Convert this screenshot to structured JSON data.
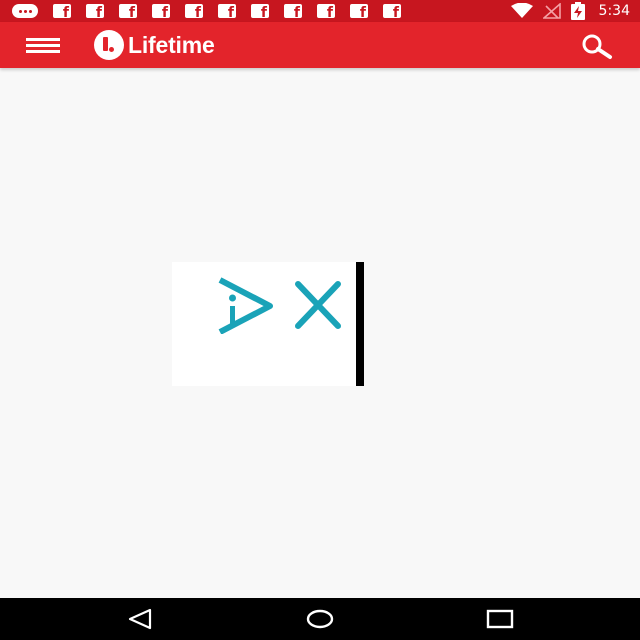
{
  "status_bar": {
    "time": "5:34",
    "notification_icons": [
      "chat-bubble-icon",
      "facebook-icon",
      "facebook-icon",
      "facebook-icon",
      "facebook-icon",
      "facebook-icon",
      "facebook-icon",
      "facebook-icon",
      "facebook-icon",
      "facebook-icon",
      "facebook-icon",
      "facebook-icon"
    ],
    "system_icons": [
      "wifi-icon",
      "no-signal-icon",
      "battery-charging-icon"
    ]
  },
  "app_bar": {
    "logo_text": "Lifetime",
    "menu_icon": "hamburger-menu-icon",
    "search_icon": "search-icon",
    "background_color": "#e3242b"
  },
  "ad": {
    "choices_icon": "adchoices-icon",
    "close_icon": "close-icon",
    "accent_color": "#1aa3b8"
  },
  "nav_bar": {
    "back_icon": "back-triangle-icon",
    "home_icon": "home-circle-icon",
    "recents_icon": "recents-square-icon"
  }
}
